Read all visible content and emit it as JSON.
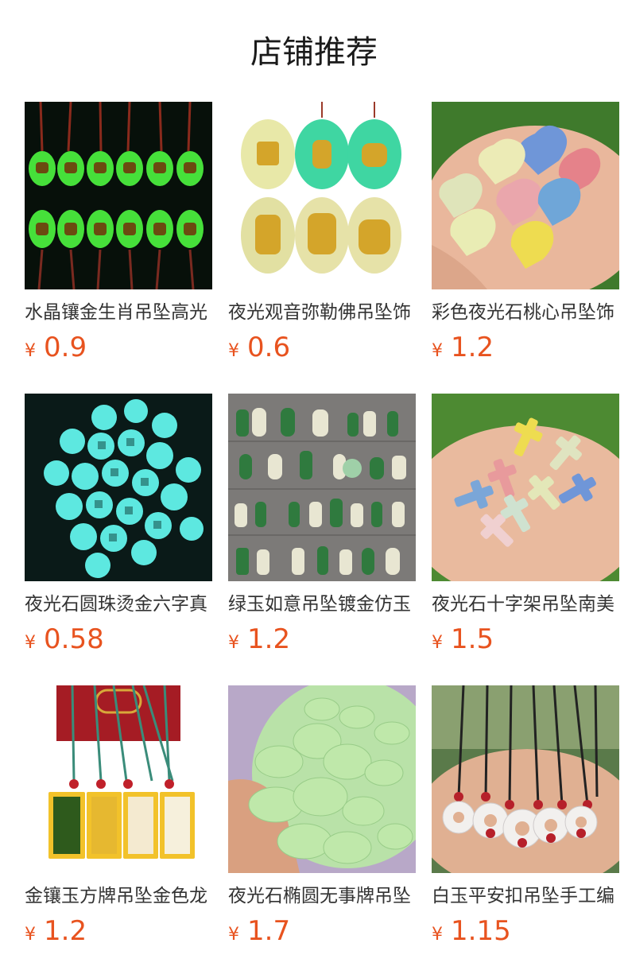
{
  "page": {
    "title": "店铺推荐"
  },
  "products": [
    {
      "name": "水晶镶金生肖吊坠高光",
      "currency": "¥",
      "price": "0.9",
      "image": "glowing-zodiac-pendants"
    },
    {
      "name": "夜光观音弥勒佛吊坠饰",
      "currency": "¥",
      "price": "0.6",
      "image": "luminous-buddha-pendants"
    },
    {
      "name": "彩色夜光石桃心吊坠饰",
      "currency": "¥",
      "price": "1.2",
      "image": "colored-heart-stones-in-hand"
    },
    {
      "name": "夜光石圆珠烫金六字真",
      "currency": "¥",
      "price": "0.58",
      "image": "glowing-mantra-beads"
    },
    {
      "name": "绿玉如意吊坠镀金仿玉",
      "currency": "¥",
      "price": "1.2",
      "image": "jade-pendant-assortment"
    },
    {
      "name": "夜光石十字架吊坠南美",
      "currency": "¥",
      "price": "1.5",
      "image": "cross-pendants-in-hand"
    },
    {
      "name": "金镶玉方牌吊坠金色龙",
      "currency": "¥",
      "price": "1.2",
      "image": "gold-jade-dragon-plaques"
    },
    {
      "name": "夜光石椭圆无事牌吊坠",
      "currency": "¥",
      "price": "1.7",
      "image": "green-oval-stones-in-hand"
    },
    {
      "name": "白玉平安扣吊坠手工编",
      "currency": "¥",
      "price": "1.15",
      "image": "white-donut-pendants-in-hand"
    }
  ],
  "colors": {
    "price": "#e8531f",
    "text": "#333333",
    "title": "#1a1a1a"
  }
}
